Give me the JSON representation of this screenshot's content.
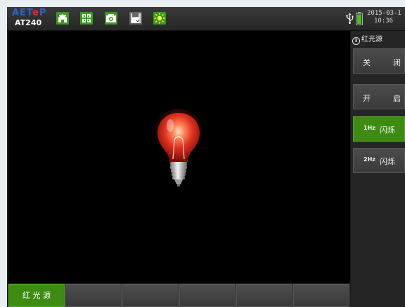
{
  "header": {
    "brand": "AETeP",
    "model": "AT240",
    "icons": [
      "home-icon",
      "fullscreen-icon",
      "camera-icon",
      "save-icon",
      "brightness-icon"
    ],
    "date": "2015-03-1",
    "time": "10:36"
  },
  "right_panel": {
    "title": "红光源",
    "buttons": [
      {
        "label_a": "关",
        "label_b": "闭",
        "active": false
      },
      {
        "label_a": "开",
        "label_b": "启",
        "active": false
      },
      {
        "hz": "1Hz",
        "label": "闪烁",
        "active": true
      },
      {
        "hz": "2Hz",
        "label": "闪烁",
        "active": false
      }
    ]
  },
  "softkeys": [
    "红 光 源",
    "",
    "",
    "",
    "",
    ""
  ],
  "colors": {
    "accent": "#3e8b12",
    "bulb_glow": "#e0311f"
  }
}
